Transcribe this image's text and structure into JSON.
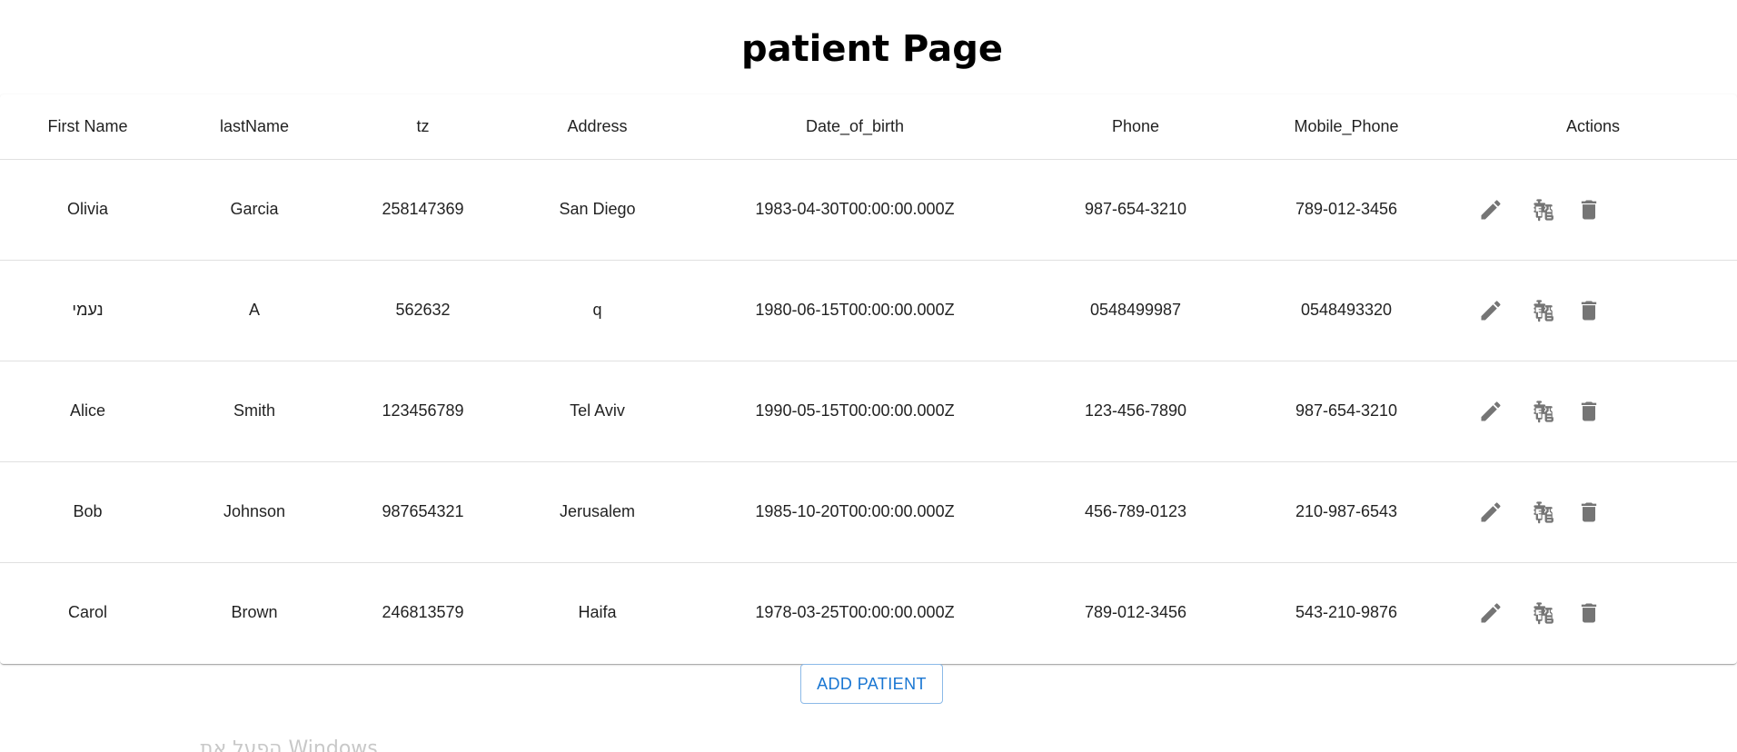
{
  "page": {
    "title": "patient Page"
  },
  "table": {
    "headers": [
      "First Name",
      "lastName",
      "tz",
      "Address",
      "Date_of_birth",
      "Phone",
      "Mobile_Phone",
      "Actions"
    ],
    "rows": [
      {
        "first_name": "Olivia",
        "last_name": "Garcia",
        "tz": "258147369",
        "address": "San Diego",
        "date_of_birth": "1983-04-30T00:00:00.000Z",
        "phone": "987-654-3210",
        "mobile_phone": "789-012-3456"
      },
      {
        "first_name": "נעמי",
        "last_name": "A",
        "tz": "562632",
        "address": "q",
        "date_of_birth": "1980-06-15T00:00:00.000Z",
        "phone": "0548499987",
        "mobile_phone": "0548493320"
      },
      {
        "first_name": "Alice",
        "last_name": "Smith",
        "tz": "123456789",
        "address": "Tel Aviv",
        "date_of_birth": "1990-05-15T00:00:00.000Z",
        "phone": "123-456-7890",
        "mobile_phone": "987-654-3210"
      },
      {
        "first_name": "Bob",
        "last_name": "Johnson",
        "tz": "987654321",
        "address": "Jerusalem",
        "date_of_birth": "1985-10-20T00:00:00.000Z",
        "phone": "456-789-0123",
        "mobile_phone": "210-987-6543"
      },
      {
        "first_name": "Carol",
        "last_name": "Brown",
        "tz": "246813579",
        "address": "Haifa",
        "date_of_birth": "1978-03-25T00:00:00.000Z",
        "phone": "789-012-3456",
        "mobile_phone": "543-210-9876"
      }
    ],
    "row_actions": [
      "edit-icon",
      "vaccine-icon",
      "delete-icon"
    ]
  },
  "actions": {
    "add_patient_label": "ADD PATIENT"
  },
  "watermark": {
    "text": "הפעל את Windows"
  },
  "colors": {
    "accent": "#1976d2",
    "icon": "#757575",
    "divider": "#e0e0e0"
  }
}
